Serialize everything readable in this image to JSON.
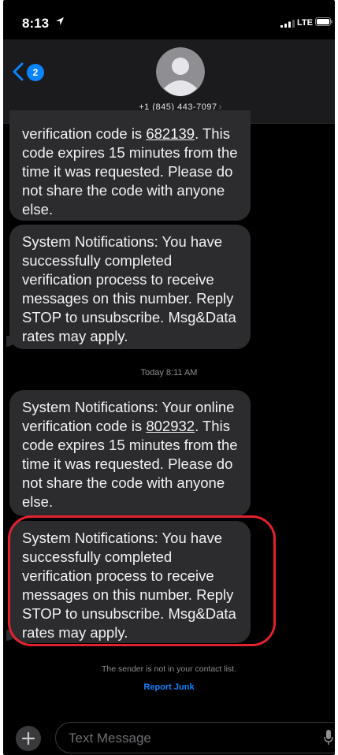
{
  "status_bar": {
    "time": "8:13",
    "carrier": "LTE"
  },
  "header": {
    "back_badge": "2",
    "contact": "+1 (845) 443-7097",
    "contact_chevron": "›"
  },
  "messages": [
    {
      "pre": "verification code is ",
      "code": "682139",
      "post": ". This code expires 15 minutes from the time it was requested. Please do not share the code with anyone else."
    },
    {
      "text": "System Notifications: You have successfully completed verification process to receive messages on this number. Reply STOP to unsubscribe. Msg&Data rates may apply."
    },
    {
      "pre": "System Notifications: Your online verification code is ",
      "code": "802932",
      "post": ". This code expires 15 minutes from the time it was requested. Please do not share the code with anyone else."
    },
    {
      "text": "System Notifications: You have successfully completed verification process to receive messages on this number. Reply STOP to unsubscribe. Msg&Data rates may apply."
    }
  ],
  "timestamp": "Today 8:11 AM",
  "footer": {
    "notice": "The sender is not in your contact list.",
    "report_junk": "Report Junk"
  },
  "compose": {
    "placeholder": "Text Message"
  },
  "colors": {
    "accent": "#0a84ff",
    "bubble": "#2c2c2e",
    "highlight": "#e3222e"
  },
  "icons": [
    "location-arrow-icon",
    "signal-icon",
    "battery-icon",
    "back-chevron-icon",
    "avatar-icon",
    "plus-icon",
    "microphone-icon"
  ]
}
